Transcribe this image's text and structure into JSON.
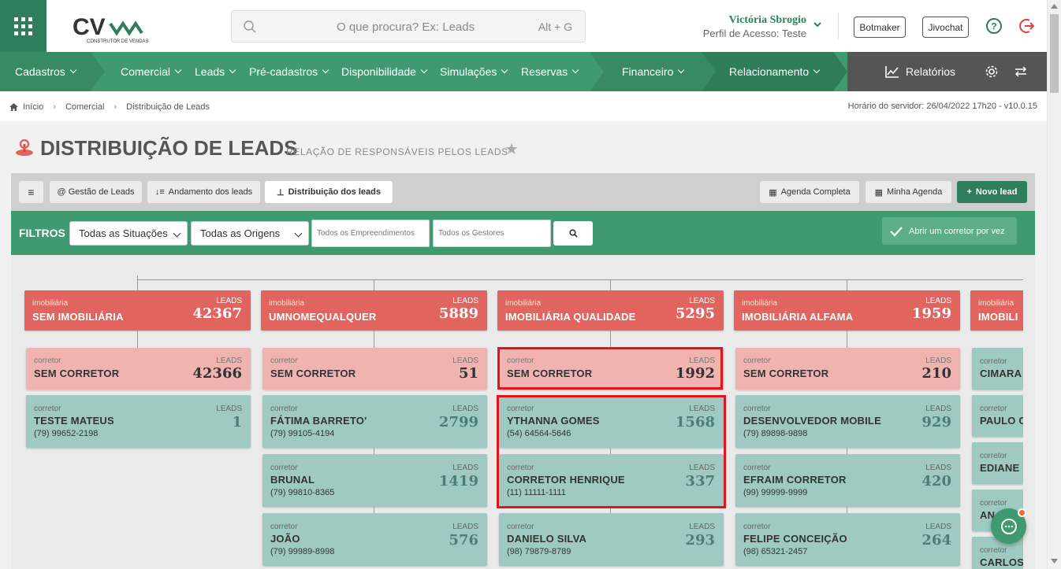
{
  "header": {
    "logo": "CV construtor de vendas",
    "search_placeholder": "O que procura? Ex: Leads",
    "search_shortcut": "Alt + G",
    "user_name": "Victória Sbrogio",
    "user_profile": "Perfil de Acesso: Teste",
    "buttons": [
      "Botmaker",
      "Jivochat"
    ]
  },
  "nav": {
    "items": [
      "Cadastros",
      "Comercial",
      "Leads",
      "Pré-cadastros",
      "Disponibilidade",
      "Simulações",
      "Reservas",
      "Financeiro",
      "Relacionamento"
    ],
    "reports": "Relatórios"
  },
  "breadcrumb": [
    "Início",
    "Comercial",
    "Distribuição de Leads"
  ],
  "server_time": "Horário do servidor: 26/04/2022 17h20 - v10.0.15",
  "page": {
    "title": "DISTRIBUIÇÃO DE LEADS",
    "subtitle": "RELAÇÃO DE RESPONSÁVEIS PELOS LEADS"
  },
  "tabs": [
    "@ Gestão de Leads",
    "Andamento dos leads",
    "Distribuição dos leads"
  ],
  "right_buttons": [
    "Agenda Completa",
    "Minha Agenda",
    "Novo lead"
  ],
  "filters": {
    "label": "FILTROS",
    "situacoes": "Todas as Situações",
    "origens": "Todas as Origens",
    "empreendimentos_placeholder": "Todos os Empreendimentos",
    "gestores_placeholder": "Todos os Gestores",
    "abrir": "Abrir um corretor por vez"
  },
  "labels": {
    "imobiliaria": "imobiliária",
    "corretor": "corretor",
    "leads": "LEADS"
  },
  "columns": [
    {
      "imob": {
        "name": "SEM IMOBILIÁRIA",
        "leads": "42367"
      },
      "sem_corretor": {
        "name": "SEM CORRETOR",
        "leads": "42366"
      },
      "corretores": [
        {
          "name": "TESTE MATEUS",
          "leads": "1",
          "phone": "(79) 99652-2198"
        }
      ]
    },
    {
      "imob": {
        "name": "UMNOMEQUALQUER",
        "leads": "5889"
      },
      "sem_corretor": {
        "name": "SEM CORRETOR",
        "leads": "51"
      },
      "corretores": [
        {
          "name": "FÁTIMA BARRETO'",
          "leads": "2799",
          "phone": "(79) 99105-4194"
        },
        {
          "name": "BRUNAL",
          "leads": "1419",
          "phone": "(79) 99810-8365"
        },
        {
          "name": "JOÃO",
          "leads": "576",
          "phone": "(79) 99989-8998"
        }
      ]
    },
    {
      "imob": {
        "name": "IMOBILIÁRIA QUALIDADE",
        "leads": "5295"
      },
      "sem_corretor": {
        "name": "SEM CORRETOR",
        "leads": "1992"
      },
      "corretores": [
        {
          "name": "YTHANNA GOMES",
          "leads": "1568",
          "phone": "(54) 64564-5646"
        },
        {
          "name": "CORRETOR HENRIQUE",
          "leads": "337",
          "phone": "(11) 11111-1111"
        },
        {
          "name": "DANIELO SILVA",
          "leads": "293",
          "phone": "(98) 79879-8789"
        }
      ]
    },
    {
      "imob": {
        "name": "IMOBILIÁRIA ALFAMA",
        "leads": "1959"
      },
      "sem_corretor": {
        "name": "SEM CORRETOR",
        "leads": "210"
      },
      "corretores": [
        {
          "name": "DESENVOLVEDOR MOBILE",
          "leads": "929",
          "phone": "(79) 89898-9898"
        },
        {
          "name": "EFRAIM CORRETOR",
          "leads": "420",
          "phone": "(99) 99999-9999"
        },
        {
          "name": "FELIPE CONCEIÇÃO",
          "leads": "264",
          "phone": "(98) 65321-2457"
        }
      ]
    },
    {
      "imob": {
        "name": "IMOBILI",
        "leads": ""
      },
      "sem_corretor": {
        "name": "CIMARA",
        "leads": ""
      },
      "corretores": [
        {
          "name": "PAULO C",
          "leads": "",
          "phone": ""
        },
        {
          "name": "EDIANE",
          "leads": "",
          "phone": ""
        },
        {
          "name": "AN",
          "leads": "",
          "phone": ""
        },
        {
          "name": "CARLOS",
          "leads": "",
          "phone": ""
        }
      ]
    }
  ]
}
